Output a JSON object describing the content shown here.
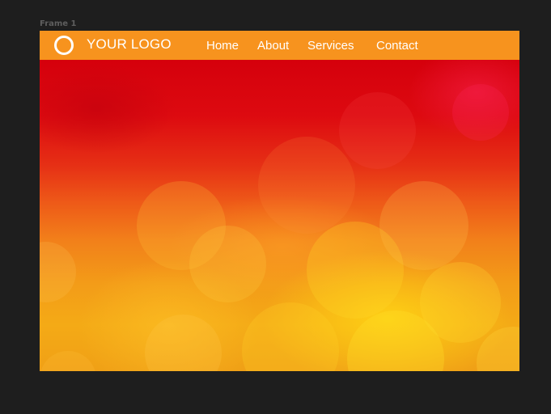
{
  "canvas": {
    "frame_label": "Frame 1"
  },
  "header": {
    "logo_text": "YOUR LOGO",
    "nav": {
      "home": "Home",
      "about": "About",
      "services": "Services",
      "contact": "Contact"
    }
  },
  "colors": {
    "canvas_background": "#1e1e1e",
    "navbar_background": "#f7931e",
    "nav_text": "#ffffff",
    "hero_top": "#d5000c",
    "hero_bottom": "#f4aa16"
  },
  "icons": {
    "logo": "ring-logo-icon"
  }
}
